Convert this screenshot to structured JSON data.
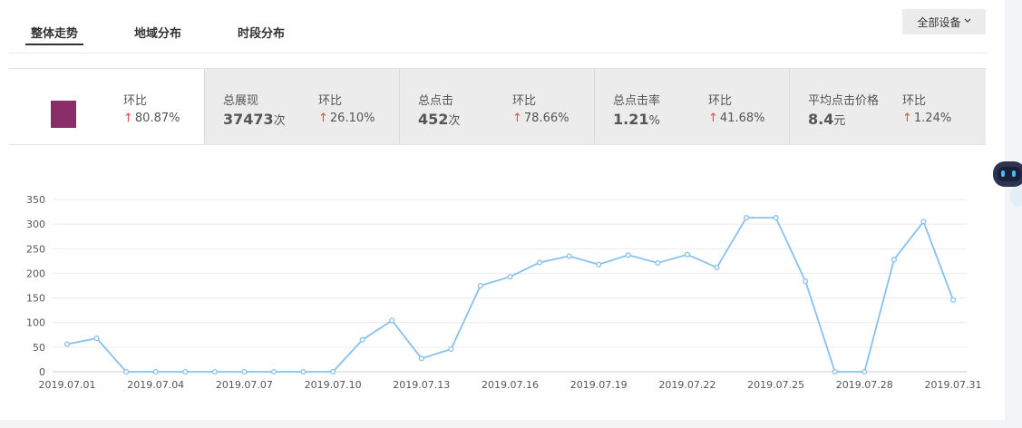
{
  "tabs": [
    {
      "label": "整体走势",
      "active": true
    },
    {
      "label": "地域分布",
      "active": false
    },
    {
      "label": "时段分布",
      "active": false
    }
  ],
  "device_select": {
    "label": "全部设备",
    "icon": "chevron-down-icon"
  },
  "stats": {
    "first": {
      "swatch_color": "#8a2e69",
      "label": "环比",
      "change": "80.87%",
      "change_icon": "arrow-up-icon"
    },
    "impressions": {
      "label": "总展现",
      "value": "37473",
      "unit": "次",
      "change_label": "环比",
      "change": "26.10%"
    },
    "clicks": {
      "label": "总点击",
      "value": "452",
      "unit": "次",
      "change_label": "环比",
      "change": "78.66%"
    },
    "ctr": {
      "label": "总点击率",
      "value": "1.21",
      "unit": "%",
      "change_label": "环比",
      "change": "41.68%"
    },
    "cpc": {
      "label": "平均点击价格",
      "value": "8.4",
      "unit": "元",
      "change_label": "环比",
      "change": "1.24%"
    }
  },
  "colors": {
    "line": "#88c0ee",
    "up_arrow": "#e8474b",
    "grid": "#ebebeb"
  },
  "chart_data": {
    "type": "line",
    "x": [
      "2019.07.01",
      "2019.07.02",
      "2019.07.03",
      "2019.07.04",
      "2019.07.05",
      "2019.07.06",
      "2019.07.07",
      "2019.07.08",
      "2019.07.09",
      "2019.07.10",
      "2019.07.11",
      "2019.07.12",
      "2019.07.13",
      "2019.07.14",
      "2019.07.15",
      "2019.07.16",
      "2019.07.17",
      "2019.07.18",
      "2019.07.19",
      "2019.07.20",
      "2019.07.21",
      "2019.07.22",
      "2019.07.23",
      "2019.07.24",
      "2019.07.25",
      "2019.07.26",
      "2019.07.27",
      "2019.07.28",
      "2019.07.29",
      "2019.07.30",
      "2019.07.31"
    ],
    "x_tick_labels": [
      "2019.07.01",
      "2019.07.04",
      "2019.07.07",
      "2019.07.10",
      "2019.07.13",
      "2019.07.16",
      "2019.07.19",
      "2019.07.22",
      "2019.07.25",
      "2019.07.28",
      "2019.07.31"
    ],
    "series": [
      {
        "values": [
          56,
          68,
          0,
          0,
          0,
          0,
          0,
          0,
          0,
          0,
          65,
          104,
          27,
          46,
          175,
          193,
          222,
          235,
          218,
          237,
          221,
          238,
          212,
          313,
          313,
          184,
          0,
          0,
          228,
          305,
          146
        ]
      }
    ],
    "ylim": [
      0,
      350
    ],
    "y_ticks": [
      0,
      50,
      100,
      150,
      200,
      250,
      300,
      350
    ],
    "grid": true
  }
}
